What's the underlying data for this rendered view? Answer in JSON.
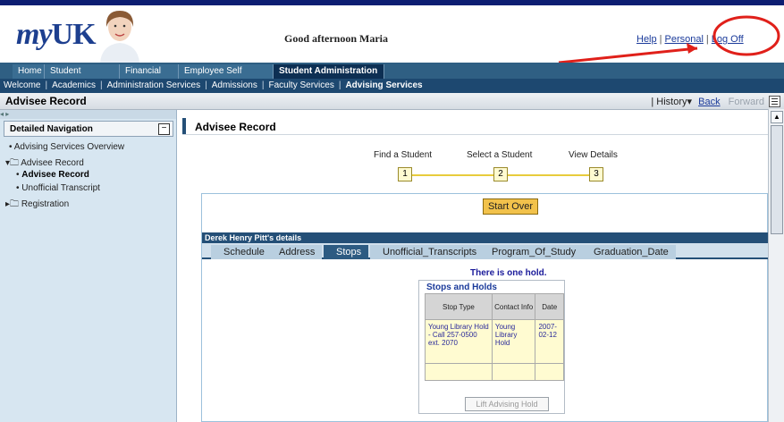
{
  "header": {
    "logo_my": "my",
    "logo_uk": "UK",
    "greeting": "Good afternoon Maria",
    "links": [
      "Help",
      "Personal",
      "Log Off"
    ]
  },
  "main_tabs": [
    "Home",
    "Student Services",
    "Financial Aid",
    "Employee Self Service",
    "Student Administration"
  ],
  "sub_nav": [
    "Welcome",
    "Academics",
    "Administration Services",
    "Admissions",
    "Faculty Services",
    "Advising Services"
  ],
  "title_bar": {
    "title": "Advisee Record",
    "history": "History",
    "back": "Back",
    "forward": "Forward"
  },
  "left_nav": {
    "expand_markers": "◂ ▸",
    "heading": "Detailed Navigation",
    "collapse": "−",
    "items": [
      "Advising Services Overview",
      "Advisee Record",
      "Advisee Record",
      "Unofficial Transcript",
      "Registration"
    ]
  },
  "content": {
    "title": "Advisee Record",
    "steps": [
      {
        "label": "Find a Student",
        "num": "1"
      },
      {
        "label": "Select a Student",
        "num": "2"
      },
      {
        "label": "View Details",
        "num": "3"
      }
    ],
    "start_over": "Start Over",
    "details_title": "Derek Henry Pitt's details",
    "tabs": [
      "Schedule",
      "Address",
      "Stops",
      "Unofficial_Transcripts",
      "Program_Of_Study",
      "Graduation_Date"
    ],
    "hold_message": "There is one hold.",
    "stops_title": "Stops and Holds",
    "table": {
      "headers": [
        "Stop Type",
        "Contact Info",
        "Date"
      ],
      "rows": [
        [
          "Young Library Hold - Call 257-0500 ext. 2070",
          "Young Library Hold",
          "2007-02-12"
        ]
      ]
    },
    "lift_button": "Lift Advising Hold"
  },
  "colors": {
    "brand_dark": "#0d1e72",
    "nav_blue": "#2f5f83",
    "accent_yellow": "#f2c24b",
    "annotation_red": "#e0201a"
  }
}
